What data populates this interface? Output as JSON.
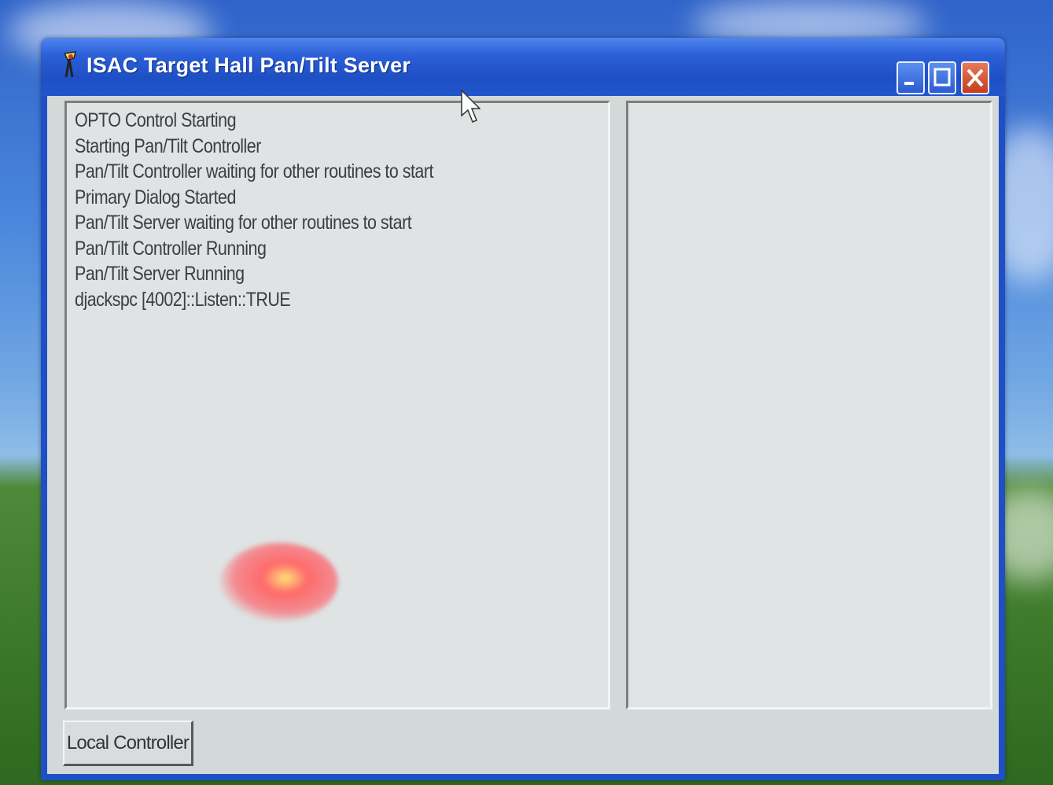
{
  "window": {
    "title": "ISAC Target Hall Pan/Tilt Server",
    "icon": "app-icon",
    "controls": [
      "minimize-icon",
      "maximize-icon",
      "close-icon"
    ]
  },
  "log": {
    "lines": [
      "OPTO Control Starting",
      "Starting Pan/Tilt Controller",
      "Pan/Tilt Controller waiting for other routines to start",
      "Primary Dialog Started",
      "Pan/Tilt Server waiting for other routines to start",
      "Pan/Tilt Controller Running",
      "Pan/Tilt Server Running",
      "djackspc [4002]::Listen::TRUE"
    ]
  },
  "buttons": {
    "local_controller": "Local Controller"
  },
  "colors": {
    "titlebar": "#2c5fd8",
    "client": "#d3d8d9",
    "close_button": "#c53d1c"
  }
}
